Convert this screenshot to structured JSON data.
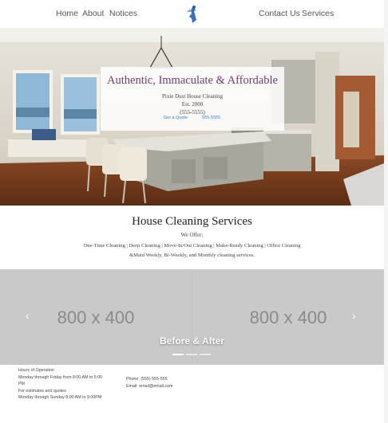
{
  "nav": {
    "home": "Home",
    "about": "About",
    "notices": "Notices",
    "contact": "Contact Us",
    "services": "Services"
  },
  "hero": {
    "title": "Authentic, Immaculate & Affordable",
    "company": "Pixie Dust House Cleaning",
    "established": "Est. 2000",
    "phone": "(555-5555)",
    "quote_link": "Get a Quote",
    "phone_link": "555-5555"
  },
  "services": {
    "heading": "House Cleaning Services",
    "offer": "We Offer:",
    "list_line1": "One-Time Cleaning | Deep Cleaning | Move-In/Out Cleaning | Make-Ready Cleaning | Office Cleaning",
    "list_line2": "&Maid Weekly, Bi-Weekly, and Monthly cleaning services."
  },
  "carousel": {
    "slide1": "800 x 400",
    "slide2": "800 x 400",
    "caption": "Before & After",
    "prev": "‹",
    "next": "›"
  },
  "footer": {
    "hours_title": "Hours of Operation",
    "hours_line1": "Monday through Friday from 8:00 AM to 5:00",
    "hours_line1b": "PM",
    "estimates_title": "For estimates and quotes",
    "estimates_line": "Monday through Sunday 8:00 AM to 9:00PM",
    "phone": "Phone: (555) 555-555",
    "email": "Email: email@email.com"
  },
  "colors": {
    "title_purple": "#6b3d73",
    "link_blue": "#3a7bd5",
    "carousel_gray": "#c2c2c2"
  }
}
